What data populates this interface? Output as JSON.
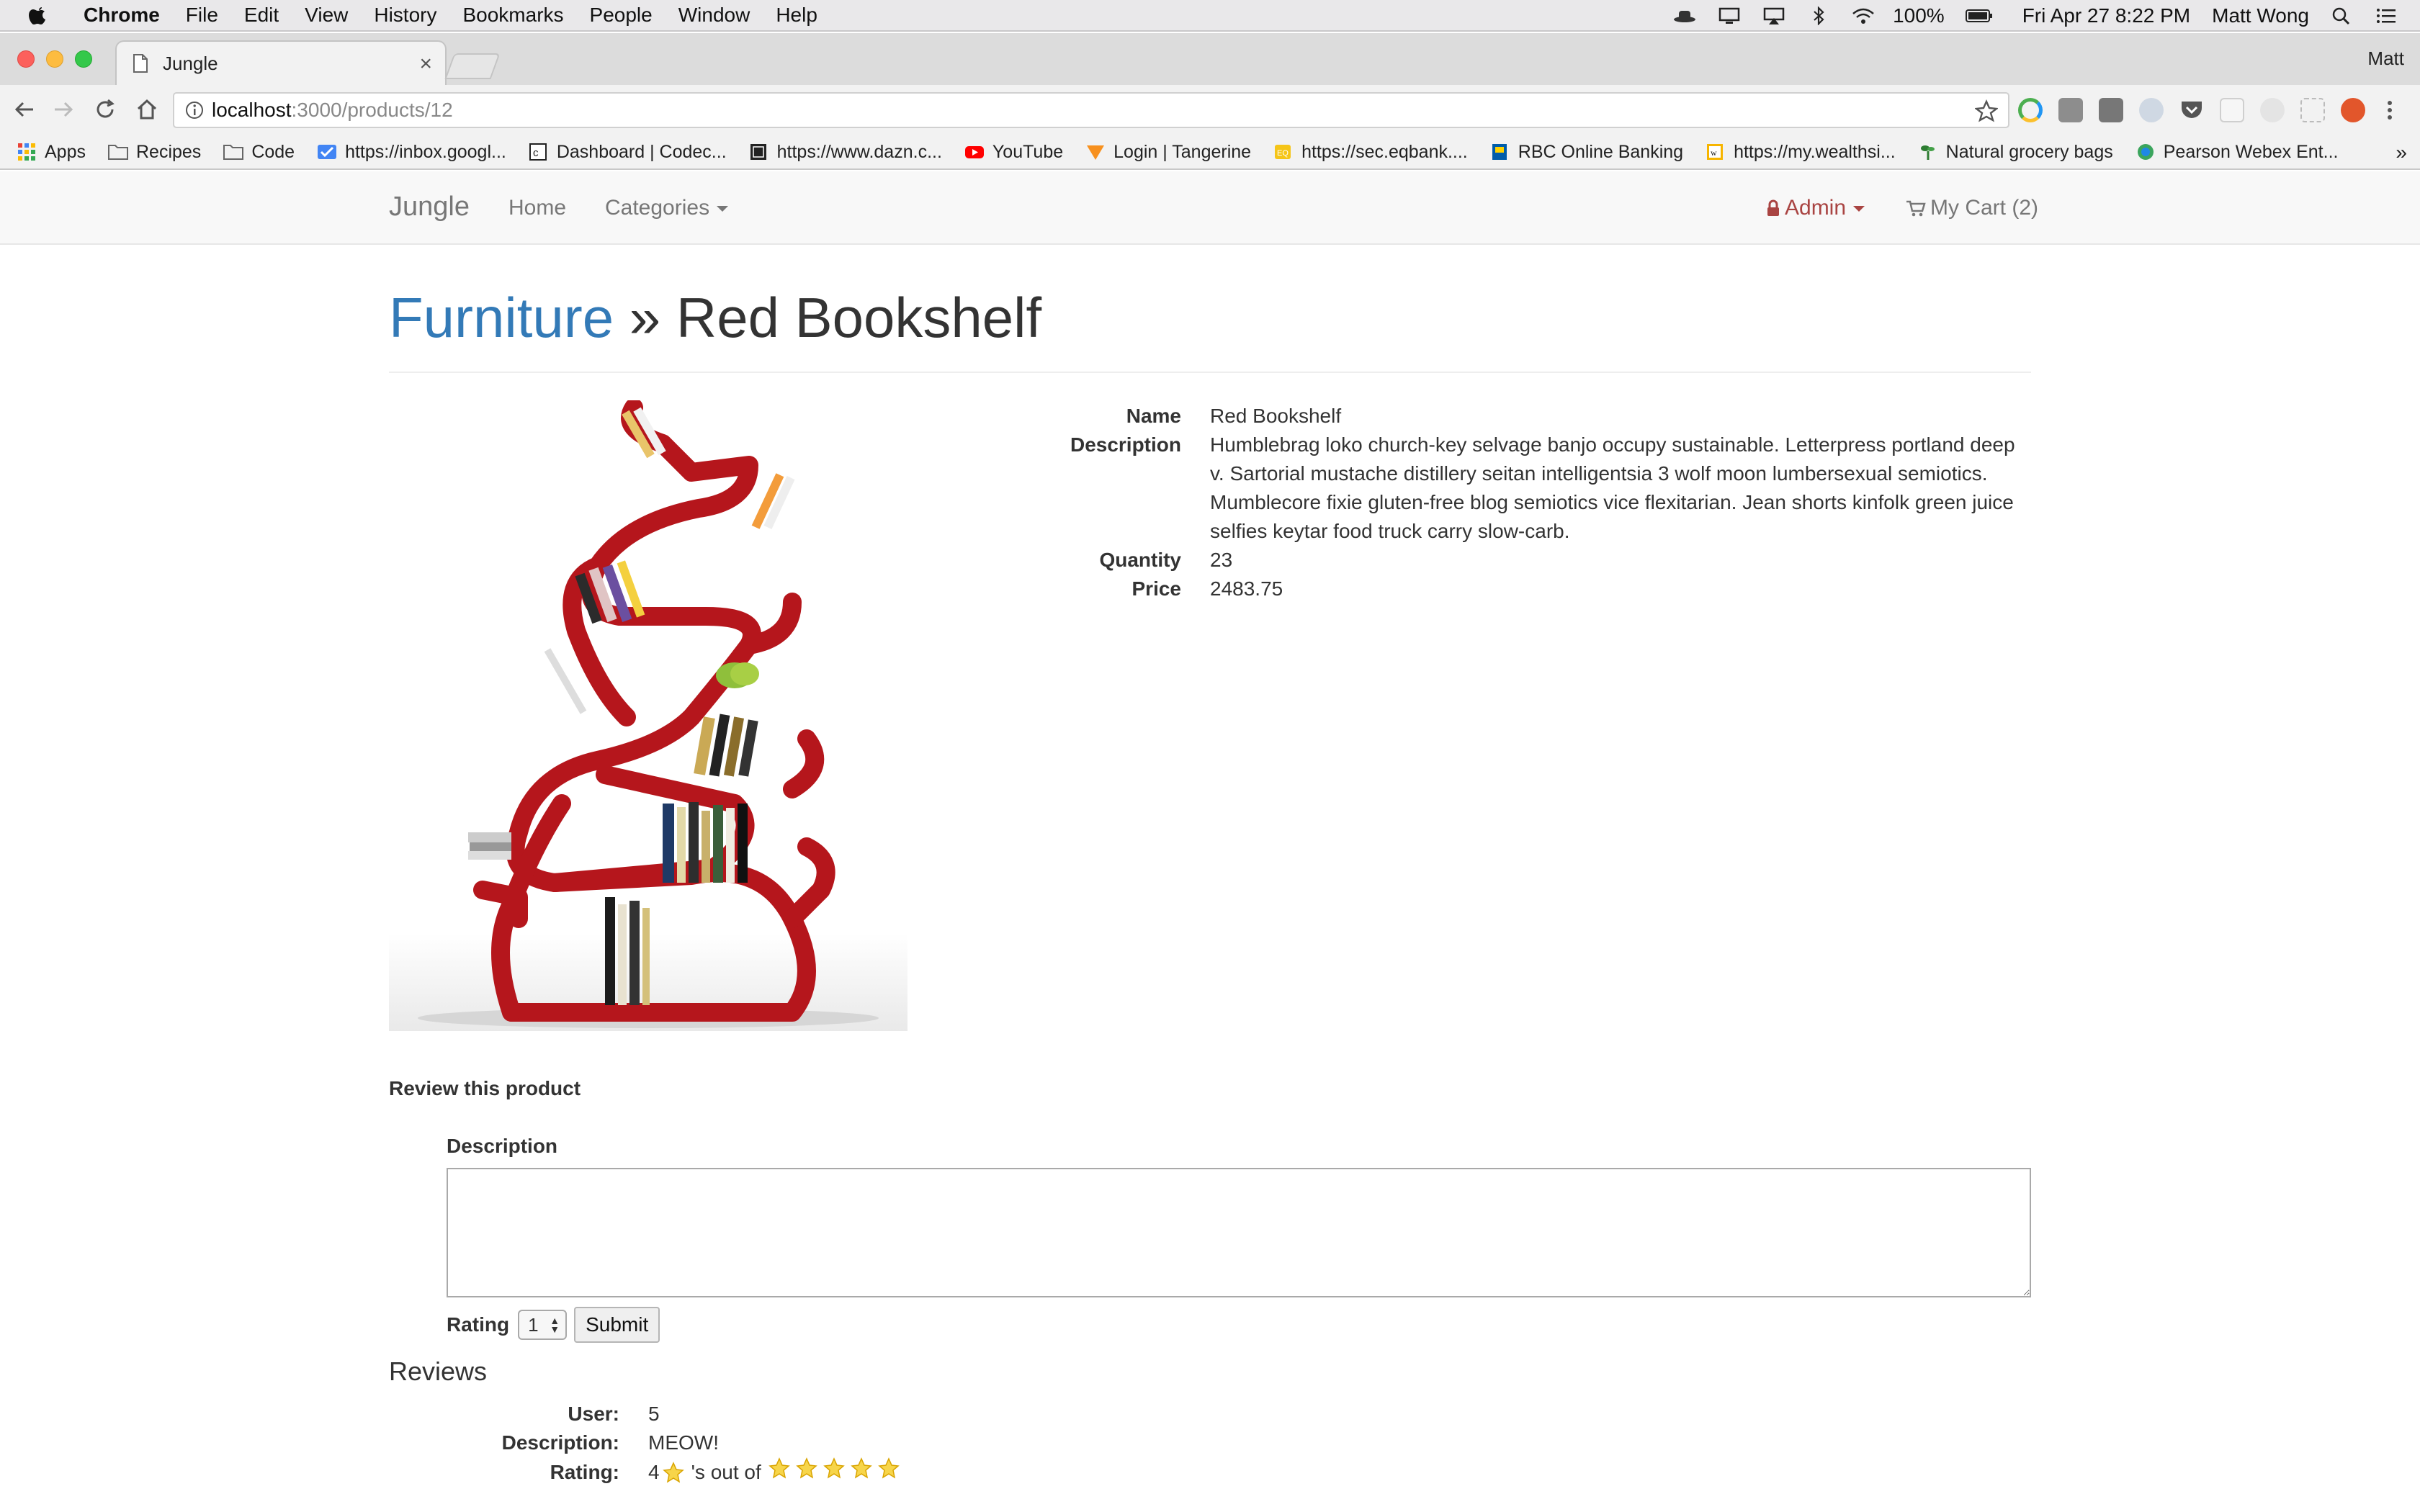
{
  "menubar": {
    "app": "Chrome",
    "items": [
      "File",
      "Edit",
      "View",
      "History",
      "Bookmarks",
      "People",
      "Window",
      "Help"
    ],
    "battery": "100%",
    "datetime": "Fri Apr 27  8:22 PM",
    "user": "Matt Wong"
  },
  "browser": {
    "tab_title": "Jungle",
    "profile": "Matt",
    "url_host": "localhost",
    "url_path": ":3000/products/12"
  },
  "bookmarks": [
    {
      "label": "Apps",
      "icon": "apps-grid-icon"
    },
    {
      "label": "Recipes",
      "icon": "folder-icon"
    },
    {
      "label": "Code",
      "icon": "folder-icon"
    },
    {
      "label": "https://inbox.googl...",
      "icon": "inbox-icon"
    },
    {
      "label": "Dashboard | Codec...",
      "icon": "codecademy-icon"
    },
    {
      "label": "https://www.dazn.c...",
      "icon": "dazn-icon"
    },
    {
      "label": "YouTube",
      "icon": "youtube-icon"
    },
    {
      "label": "Login | Tangerine",
      "icon": "tangerine-icon"
    },
    {
      "label": "https://sec.eqbank....",
      "icon": "eqbank-icon"
    },
    {
      "label": "RBC Online Banking",
      "icon": "rbc-icon"
    },
    {
      "label": "https://my.wealthsi...",
      "icon": "wealthsimple-icon"
    },
    {
      "label": "Natural grocery bags",
      "icon": "plant-icon"
    },
    {
      "label": "Pearson Webex Ent...",
      "icon": "webex-icon"
    }
  ],
  "site": {
    "brand": "Jungle",
    "nav": {
      "home": "Home",
      "categories": "Categories",
      "admin": "Admin",
      "cart": "My Cart (2)"
    }
  },
  "product": {
    "category": "Furniture",
    "separator": " » ",
    "name": "Red Bookshelf",
    "labels": {
      "name": "Name",
      "description": "Description",
      "quantity": "Quantity",
      "price": "Price"
    },
    "description": "Humblebrag loko church-key selvage banjo occupy sustainable. Letterpress portland deep v. Sartorial mustache distillery seitan intelligentsia 3 wolf moon lumbersexual semiotics. Mumblecore fixie gluten-free blog semiotics vice flexitarian. Jean shorts kinfolk green juice selfies keytar food truck carry slow-carb.",
    "quantity": "23",
    "price": "2483.75"
  },
  "review_form": {
    "title": "Review this product",
    "description_label": "Description",
    "description_value": "",
    "rating_label": "Rating",
    "rating_value": "1",
    "submit": "Submit"
  },
  "reviews": {
    "title": "Reviews",
    "labels": {
      "user": "User:",
      "description": "Description:",
      "rating": "Rating:"
    },
    "items": [
      {
        "user": "5",
        "description": "MEOW!",
        "rating": "4",
        "rating_text": "'s out of",
        "max_stars": 5
      }
    ]
  },
  "colors": {
    "link": "#337ab7",
    "admin": "#a94442",
    "shelf_red": "#b5161c"
  }
}
